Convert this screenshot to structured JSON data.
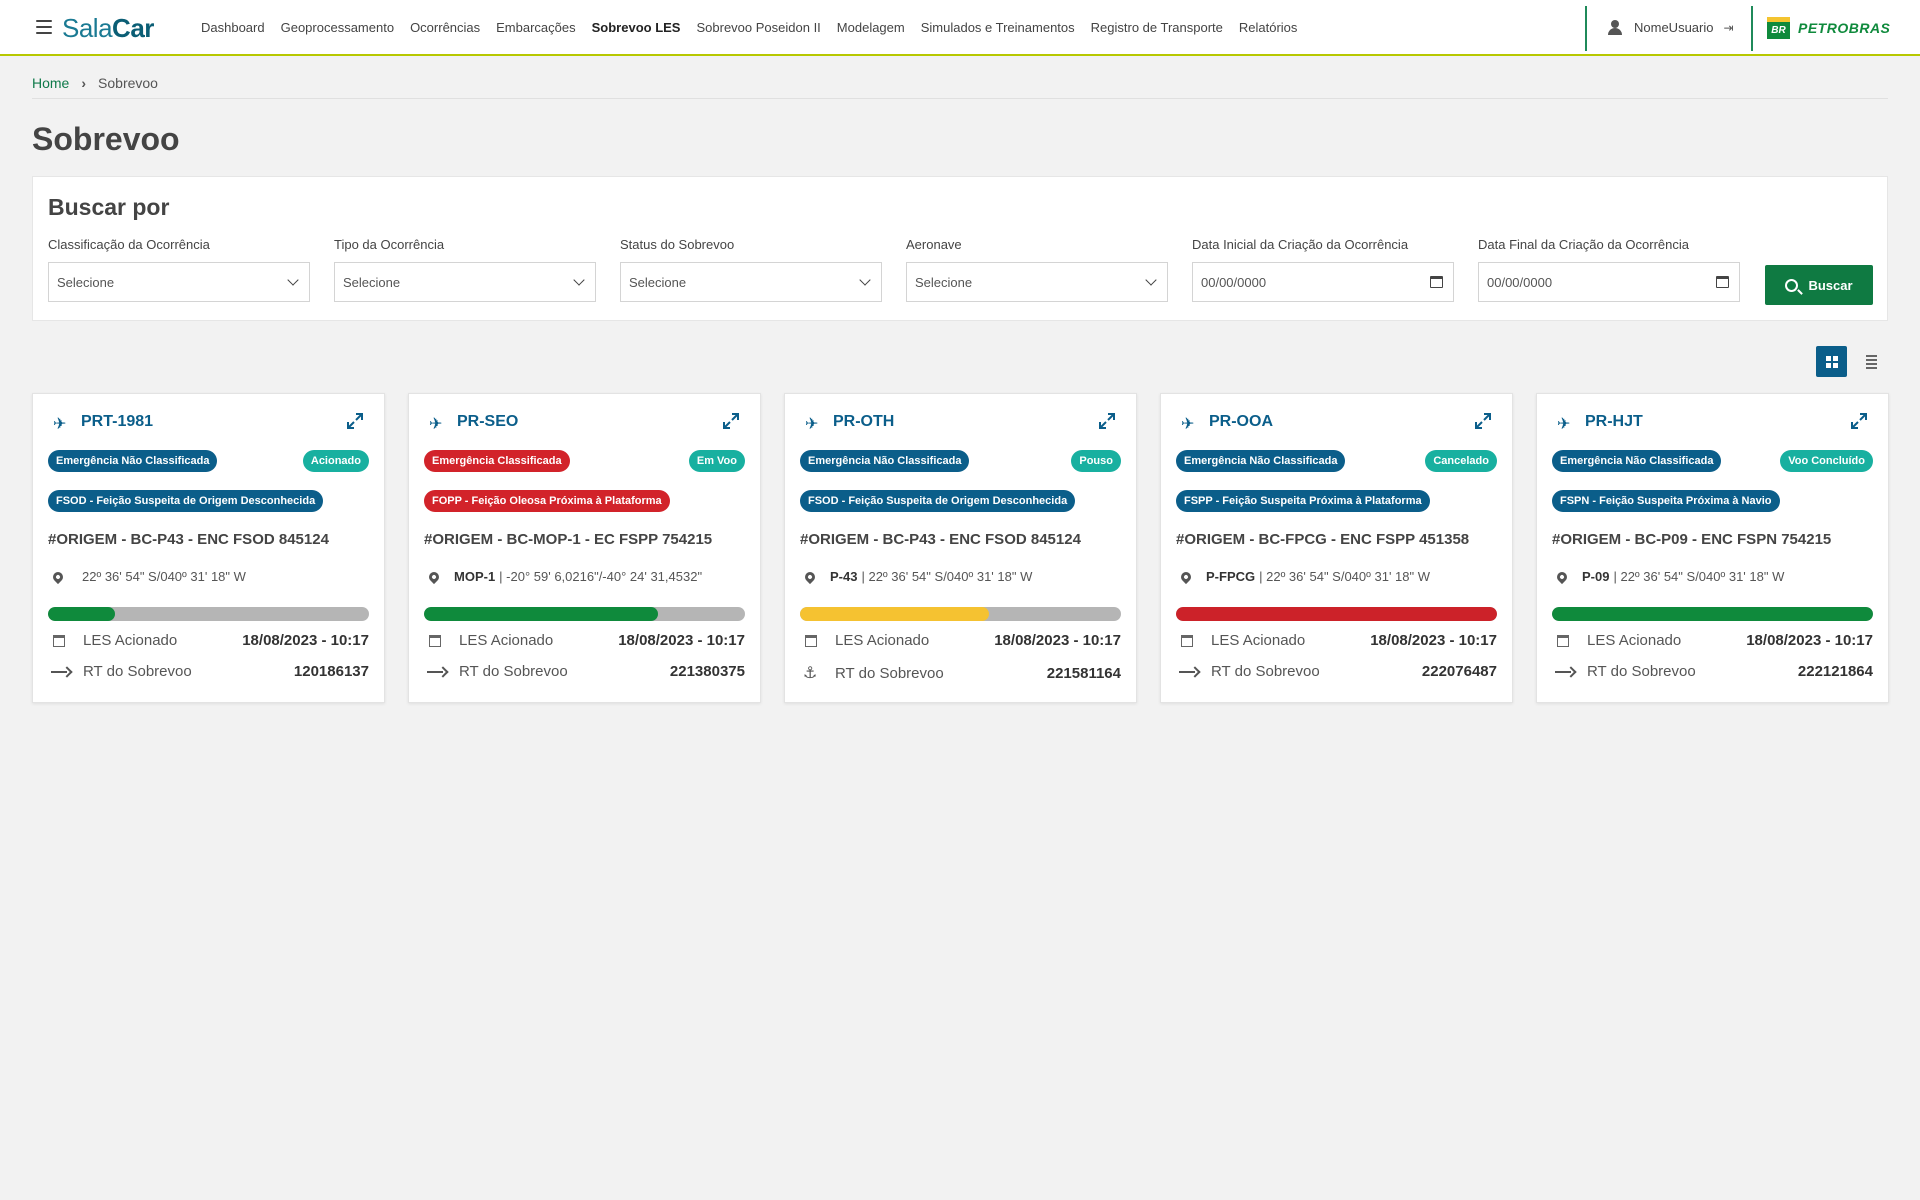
{
  "header": {
    "logo_light": "Sala",
    "logo_bold": "Car",
    "nav": [
      "Dashboard",
      "Geoprocessamento",
      "Ocorrências",
      "Embarcações",
      "Sobrevoo LES",
      "Sobrevoo Poseidon II",
      "Modelagem",
      "Simulados e Treinamentos",
      "Registro de Transporte",
      "Relatórios"
    ],
    "active_nav": "Sobrevoo LES",
    "user_name": "NomeUsuario",
    "brand_badge": "BR",
    "brand_name": "PETROBRAS"
  },
  "breadcrumb": {
    "home": "Home",
    "current": "Sobrevoo"
  },
  "page_title": "Sobrevoo",
  "search": {
    "title": "Buscar por",
    "fields": [
      {
        "label": "Classificação da Ocorrência",
        "value": "Selecione",
        "kind": "select"
      },
      {
        "label": "Tipo da Ocorrência",
        "value": "Selecione",
        "kind": "select"
      },
      {
        "label": "Status do Sobrevoo",
        "value": "Selecione",
        "kind": "select"
      },
      {
        "label": "Aeronave",
        "value": "Selecione",
        "kind": "select"
      },
      {
        "label": "Data Inicial da Criação da Ocorrência",
        "value": "00/00/0000",
        "kind": "date"
      },
      {
        "label": "Data Final da Criação da Ocorrência",
        "value": "00/00/0000",
        "kind": "date"
      }
    ],
    "button": "Buscar"
  },
  "colors": {
    "primary": "#0b5e8a",
    "class_blue": "#0b5e8a",
    "class_red": "#d2232a",
    "status_teal": "#18b0a0",
    "progress_green": "#0f8a3c",
    "progress_yellow": "#f5c231",
    "progress_red": "#cc2229",
    "button_green": "#0f7a42"
  },
  "cards": [
    {
      "registration": "PRT-1981",
      "classification": "Emergência Não Classificada",
      "classification_color": "#0b5e8a",
      "status": "Acionado",
      "type": "FSOD - Feição Suspeita de Origem Desconhecida",
      "type_color": "#0b5e8a",
      "title": "#ORIGEM - BC-P43 - ENC FSOD 845124",
      "location_code": "",
      "location": "22º 36' 54\" S/040º 31' 18\" W",
      "progress": 0.21,
      "progress_color": "#0f8a3c",
      "row1_label": "LES Acionado",
      "row1_value": "18/08/2023 - 10:17",
      "row2_icon": "arrow-right-icon",
      "row2_label": "RT do Sobrevoo",
      "row2_value": "120186137"
    },
    {
      "registration": "PR-SEO",
      "classification": "Emergência Classificada",
      "classification_color": "#d2232a",
      "status": "Em Voo",
      "type": "FOPP - Feição Oleosa Próxima à Plataforma",
      "type_color": "#d2232a",
      "title": "#ORIGEM - BC-MOP-1 - EC FSPP 754215",
      "location_code": "MOP-1",
      "location": "| -20° 59' 6,0216\"/-40° 24' 31,4532\"",
      "progress": 0.73,
      "progress_color": "#0f8a3c",
      "row1_label": "LES Acionado",
      "row1_value": "18/08/2023 - 10:17",
      "row2_icon": "arrow-right-icon",
      "row2_label": "RT do Sobrevoo",
      "row2_value": "221380375"
    },
    {
      "registration": "PR-OTH",
      "classification": "Emergência Não Classificada",
      "classification_color": "#0b5e8a",
      "status": "Pouso",
      "type": "FSOD - Feição Suspeita de Origem Desconhecida",
      "type_color": "#0b5e8a",
      "title": "#ORIGEM - BC-P43 - ENC FSOD 845124",
      "location_code": "P-43",
      "location": "| 22º 36' 54\" S/040º 31' 18\" W",
      "progress": 0.59,
      "progress_color": "#f5c231",
      "row1_label": "LES Acionado",
      "row1_value": "18/08/2023 - 10:17",
      "row2_icon": "anchor-icon",
      "row2_label": "RT do Sobrevoo",
      "row2_value": "221581164"
    },
    {
      "registration": "PR-OOA",
      "classification": "Emergência Não Classificada",
      "classification_color": "#0b5e8a",
      "status": "Cancelado",
      "type": "FSPP - Feição Suspeita Próxima à Plataforma",
      "type_color": "#0b5e8a",
      "title": "#ORIGEM - BC-FPCG - ENC FSPP 451358",
      "location_code": "P-FPCG",
      "location": "| 22º 36' 54\" S/040º 31' 18\" W",
      "progress": 1.0,
      "progress_color": "#cc2229",
      "row1_label": "LES Acionado",
      "row1_value": "18/08/2023 - 10:17",
      "row2_icon": "arrow-right-icon",
      "row2_label": "RT do Sobrevoo",
      "row2_value": "222076487"
    },
    {
      "registration": "PR-HJT",
      "classification": "Emergência Não Classificada",
      "classification_color": "#0b5e8a",
      "status": "Voo Concluído",
      "type": "FSPN - Feição Suspeita Próxima à Navio",
      "type_color": "#0b5e8a",
      "title": "#ORIGEM - BC-P09 - ENC FSPN 754215",
      "location_code": "P-09",
      "location": "| 22º 36' 54\" S/040º 31' 18\" W",
      "progress": 1.0,
      "progress_color": "#0f8a3c",
      "row1_label": "LES Acionado",
      "row1_value": "18/08/2023 - 10:17",
      "row2_icon": "arrow-right-icon",
      "row2_label": "RT do Sobrevoo",
      "row2_value": "222121864"
    }
  ]
}
